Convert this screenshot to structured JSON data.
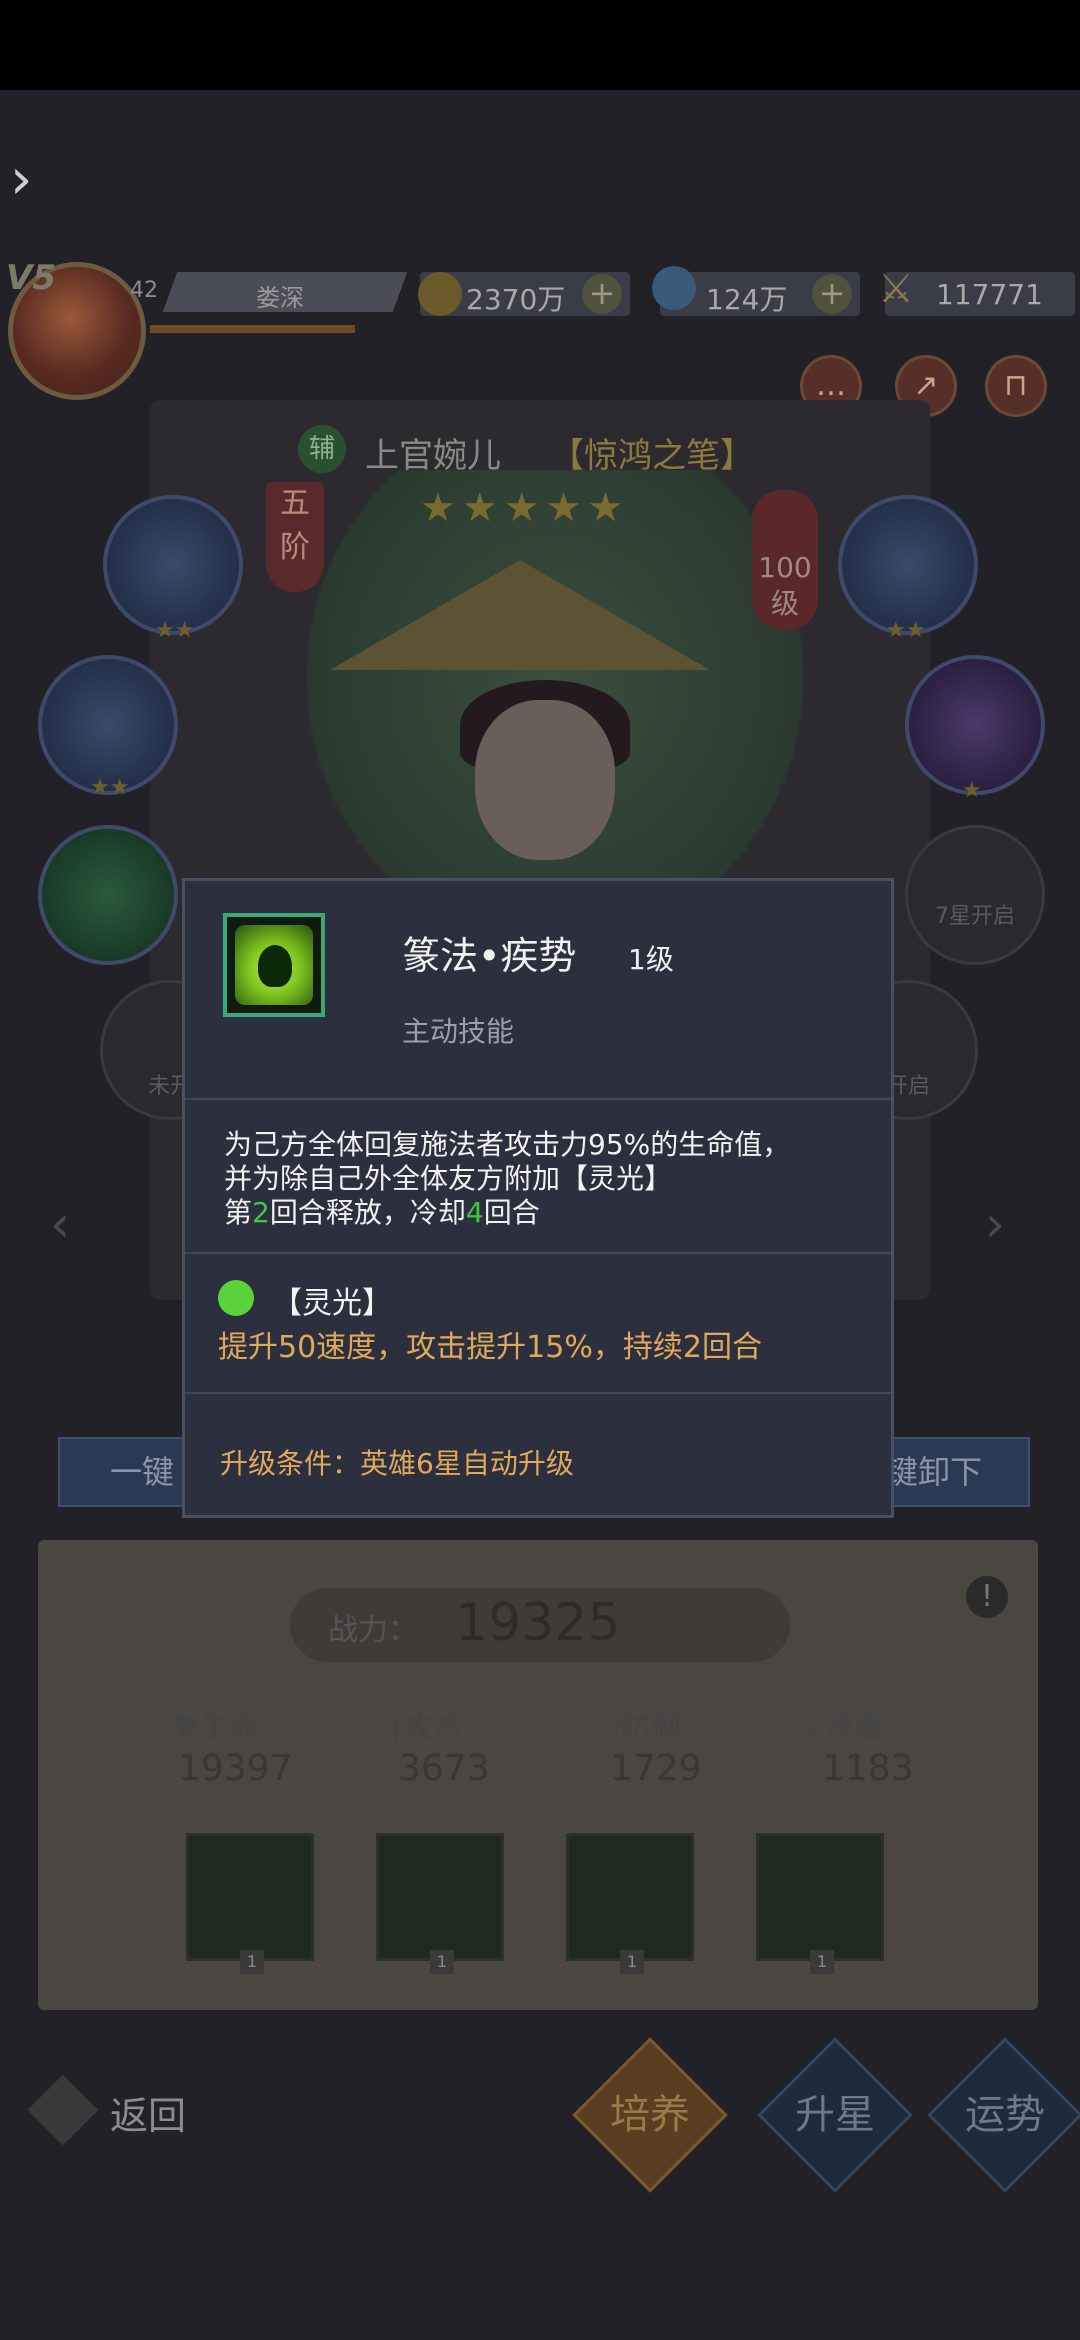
{
  "top": {
    "vip": "V5",
    "player_level": "42",
    "player_name": "娄深",
    "gold": "2370万",
    "potion": "124万",
    "power": "117771"
  },
  "hero": {
    "class_badge": "辅",
    "name": "上官婉儿",
    "title": "【惊鸿之笔】",
    "rank_line1": "五",
    "rank_line2": "阶",
    "level_line1": "100",
    "level_line2": "级",
    "stars": "★★★★★",
    "equip_stars_1": "★★",
    "equip_stars_2": "★★",
    "equip_stars_3": "★★",
    "equip_stars_4": "★",
    "lock_right": "7星开启",
    "lock_left": "未开",
    "lock_right2": "开启"
  },
  "buttons": {
    "one_key_left": "一键",
    "one_key_right": "键卸下"
  },
  "stats": {
    "power_label": "战力：",
    "power_value": "19325",
    "hp_label": "生命",
    "hp_value": "19397",
    "atk_label": "攻击",
    "atk_value": "3673",
    "def_label": "防御",
    "def_value": "1729",
    "spd_label": "速度",
    "spd_value": "1183",
    "skill_levels": [
      "1",
      "1",
      "1",
      "1"
    ]
  },
  "bottom_nav": {
    "back": "返回",
    "tabs": [
      "培养",
      "升星",
      "运势"
    ]
  },
  "popup": {
    "skill_name": "篆法•疾势",
    "skill_level": "1级",
    "skill_type": "主动技能",
    "desc_line1": "为己方全体回复施法者攻击力95%的生命值，",
    "desc_line2": "并为除自己外全体友方附加【灵光】",
    "desc_line3_prefix": "第",
    "desc_line3_num1": "2",
    "desc_line3_mid": "回合释放，冷却",
    "desc_line3_num2": "4",
    "desc_line3_suffix": "回合",
    "buff_name": "【灵光】",
    "buff_desc": "提升50速度，攻击提升15%，持续2回合",
    "condition": "升级条件：英雄6星自动升级"
  },
  "colors": {
    "highlight_green": "#3ec93e",
    "orange_text": "#e2a85a",
    "popup_bg": "#2c303e",
    "icon_frame": "#3aa878"
  }
}
